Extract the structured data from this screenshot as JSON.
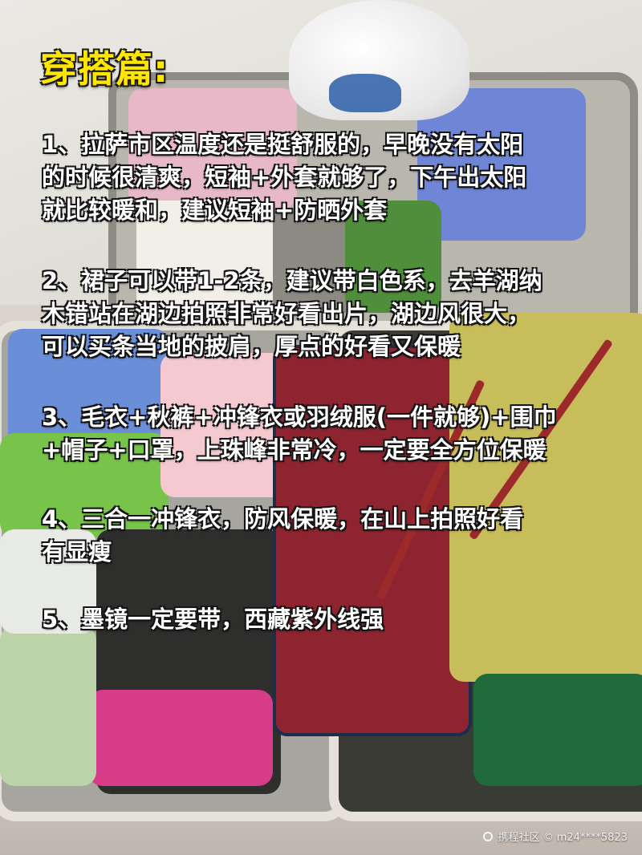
{
  "post": {
    "title": "穿搭篇:",
    "tips": [
      "1、拉萨市区温度还是挺舒服的，早晚没有太阳\n的时候很清爽，短袖+外套就够了，下午出太阳\n就比较暖和，建议短袖+防晒外套",
      "2、裙子可以带1-2条，建议带白色系，去羊湖纳\n木错站在湖边拍照非常好看出片，湖边风很大，\n可以买条当地的披肩，厚点的好看又保暖",
      "3、毛衣+秋裤+冲锋衣或羽绒服(一件就够)+围巾\n+帽子+口罩，上珠峰非常冷，一定要全方位保暖",
      "4、三合一冲锋衣，防风保暖，在山上拍照好看\n有显瘦",
      "5、墨镜一定要带，西藏紫外线强"
    ]
  },
  "watermark": {
    "text": "携程社区 © m24****5823",
    "icon": "ctrip-logo-icon"
  },
  "colors": {
    "title": "#ffe600",
    "text": "#ffffff",
    "outline": "#141414"
  }
}
